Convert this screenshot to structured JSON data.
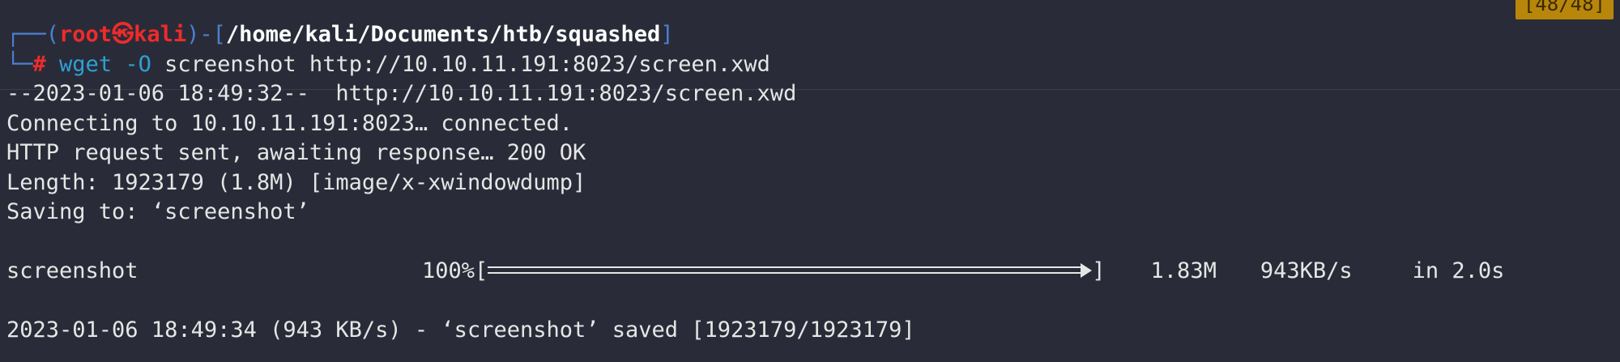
{
  "badge": {
    "text": "[48/48]"
  },
  "prompt": {
    "box_open": "┌──(",
    "user": "root",
    "skull": "㉿",
    "host": "kali",
    "box_mid": ")-[",
    "path": "/home/kali/Documents/htb/squashed",
    "box_close": "]",
    "line2_box": "└─",
    "hash": "#",
    "cmd": "wget",
    "flag": "-O",
    "args": "screenshot http://10.10.11.191:8023/screen.xwd"
  },
  "output": {
    "line1": "--2023-01-06 18:49:32--  http://10.10.11.191:8023/screen.xwd",
    "line2": "Connecting to 10.10.11.191:8023… connected.",
    "line3": "HTTP request sent, awaiting response… 200 OK",
    "line4": "Length: 1923179 (1.8M) [image/x-xwindowdump]",
    "line5": "Saving to: ‘screenshot’",
    "progress_name": "screenshot",
    "progress_percent": "100%[",
    "progress_close": "]",
    "progress_fraction": 1.0,
    "progress_size": "1.83M",
    "progress_speed": "943KB/s",
    "progress_time": "in 2.0s",
    "line_saved": "2023-01-06 18:49:34 (943 KB/s) - ‘screenshot’ saved [1923179/1923179]"
  }
}
